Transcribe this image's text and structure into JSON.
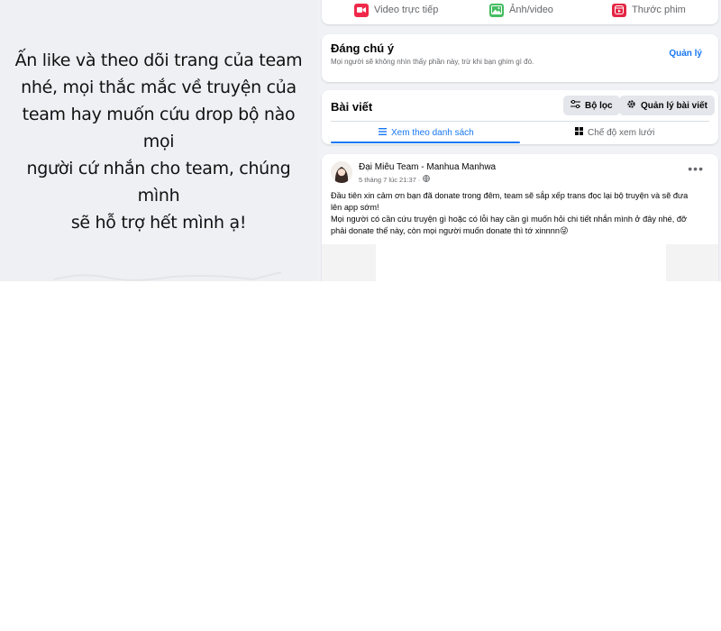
{
  "promo": {
    "lines": [
      "Ấn like và theo dõi trang của team",
      "nhé, mọi thắc mắc về truyện của",
      "team hay muốn cứu drop bộ nào mọi",
      "người cứ nhắn cho team, chúng mình",
      "sẽ hỗ trợ hết mình ạ!"
    ]
  },
  "composer": {
    "live_label": "Video trực tiếp",
    "photo_label": "Ảnh/video",
    "reel_label": "Thước phim"
  },
  "pinned": {
    "title": "Đáng chú ý",
    "description": "Mọi người sẽ không nhìn thấy phần này, trừ khi bạn ghim gì đó.",
    "manage_label": "Quản lý"
  },
  "posts_header": {
    "title": "Bài viết",
    "filter_label": "Bộ lọc",
    "manage_label": "Quản lý bài viết",
    "tab_list": "Xem theo danh sách",
    "tab_grid": "Chế độ xem lưới"
  },
  "post": {
    "author": "Đại Miêu Team - Manhua Manhwa",
    "timestamp": "5 tháng 7 lúc 21:37 ·",
    "more": "•••",
    "body_lines": [
      "Đầu tiên xin cảm ơn bạn đã donate trong đêm, team sẽ sắp xếp trans đọc lại bộ truyện và sẽ đưa",
      "lên app sớm!",
      "Mọi người có cần cứu truyện gì hoặc có lỗi hay cần gì muốn hỏi chi tiết nhắn mình ở đây nhé, đỡ",
      "phải donate thế này, còn mọi người muốn donate thì tớ xinnnn😜"
    ]
  },
  "colors": {
    "accent": "#1877f2",
    "live_icon": "#f02849",
    "photo_icon": "#45bd62",
    "reel_icon": "#e42645",
    "page_bg": "#f0f2f5"
  }
}
